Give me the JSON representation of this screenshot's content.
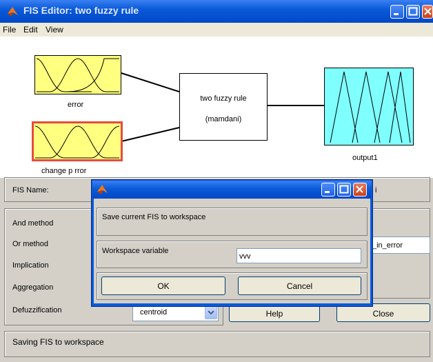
{
  "window": {
    "title": "FIS Editor: two fuzzy rule"
  },
  "menu": {
    "items": [
      "File",
      "Edit",
      "View"
    ]
  },
  "diagram": {
    "inputs": [
      "error",
      "change p rror"
    ],
    "system_name": "two fuzzy rule",
    "system_type": "(mamdani)",
    "output": "output1"
  },
  "props": {
    "fis_name_label": "FIS Name:",
    "fis_type_partial": "i",
    "and_label": "And method",
    "or_label": "Or method",
    "implication_label": "Implication",
    "aggregation_label": "Aggregation",
    "defuzz_label": "Defuzzification",
    "defuzz_value": "centroid",
    "var_name_partial": "_in_error"
  },
  "buttons": {
    "help": "Help",
    "close": "Close"
  },
  "status": {
    "text": "Saving FIS to workspace"
  },
  "dialog": {
    "prompt": "Save current FIS to workspace",
    "var_label": "Workspace variable",
    "var_value": "vvv",
    "ok": "OK",
    "cancel": "Cancel"
  },
  "colors": {
    "input_fill": "#ffff80",
    "output_fill": "#80ffff",
    "selected_border": "#e84a3c",
    "titlebar": "#0a5ad8"
  }
}
